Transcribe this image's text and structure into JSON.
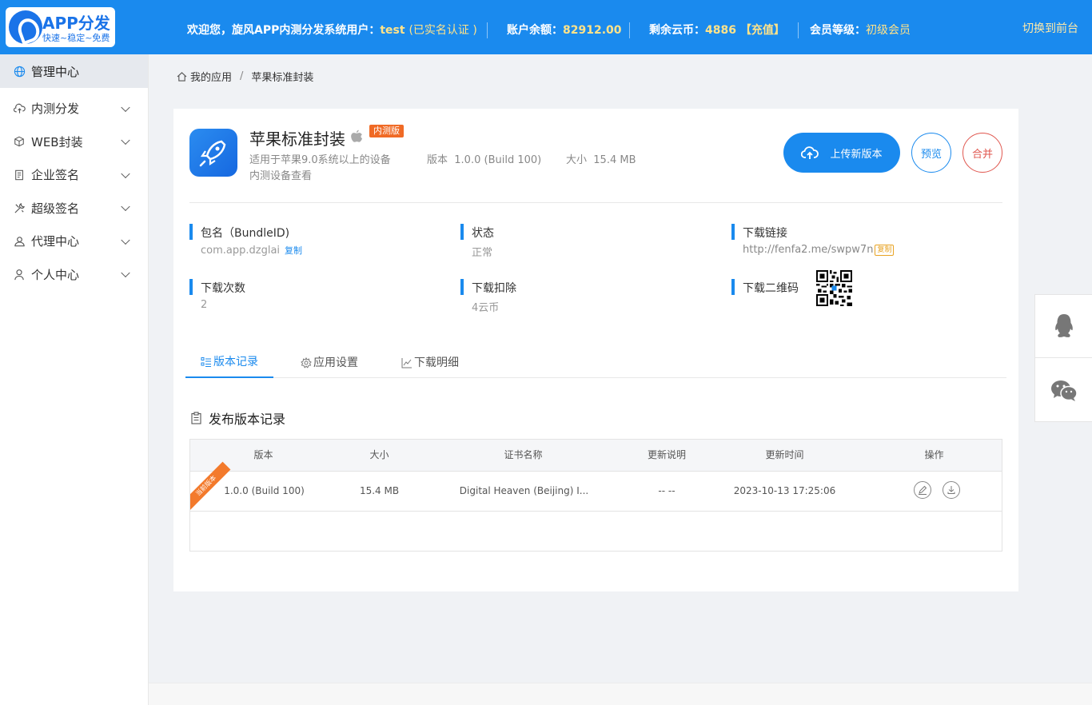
{
  "header": {
    "logo_title": "APP分发",
    "logo_sub": "快速~稳定~免费",
    "welcome_prefix": "欢迎您，旋风APP内测分发系统用户：",
    "username": "test",
    "realname": "(已实名认证 )",
    "balance_label": "账户余额：",
    "balance": "82912.00",
    "coins_label": "剩余云币：",
    "coins": "4886",
    "recharge": "【充值】",
    "level_label": "会员等级：",
    "level": "初级会员",
    "front_link": "切换到前台"
  },
  "sidebar": {
    "items": [
      {
        "label": "管理中心",
        "icon": "globe-icon"
      },
      {
        "label": "内测分发",
        "icon": "cloud-upload-icon"
      },
      {
        "label": "WEB封装",
        "icon": "cube-icon"
      },
      {
        "label": "企业签名",
        "icon": "document-icon"
      },
      {
        "label": "超级签名",
        "icon": "tools-icon"
      },
      {
        "label": "代理中心",
        "icon": "group-icon"
      },
      {
        "label": "个人中心",
        "icon": "user-icon"
      }
    ]
  },
  "breadcrumb": {
    "home": "我的应用",
    "sep": "/",
    "current": "苹果标准封装"
  },
  "app": {
    "name": "苹果标准封装",
    "badge": "内测版",
    "desc": "适用于苹果9.0系统以上的设备",
    "desc2": "内测设备查看",
    "version_label": "版本",
    "version": "1.0.0 (Build 100)",
    "size_label": "大小",
    "size": "15.4 MB"
  },
  "actions": {
    "upload": "上传新版本",
    "preview": "预览",
    "merge": "合并"
  },
  "info": {
    "bundle_label": "包名（BundleID)",
    "bundle_value": "com.app.dzglai",
    "bundle_copy": "复制",
    "status_label": "状态",
    "status_value": "正常",
    "link_label": "下载链接",
    "link_value": "http://fenfa2.me/swpw7n",
    "link_copy": "复制",
    "downloads_label": "下载次数",
    "downloads_value": "2",
    "deduct_label": "下载扣除",
    "deduct_value": "4云币",
    "qr_label": "下载二维码"
  },
  "tabs": [
    "版本记录",
    "应用设置",
    "下载明细"
  ],
  "section_title": "发布版本记录",
  "table": {
    "columns": [
      "版本",
      "大小",
      "证书名称",
      "更新说明",
      "更新时间",
      "操作"
    ],
    "rows": [
      {
        "ribbon": "当前版本",
        "version": "1.0.0 (Build 100)",
        "size": "15.4 MB",
        "cert": "Digital Heaven (Beijing) I...",
        "note": "-- --",
        "time": "2023-10-13 17:25:06"
      }
    ]
  },
  "colors": {
    "primary": "#1a8aee",
    "badge": "#f06a25",
    "danger": "#e0574f",
    "highlight": "#ffe38a"
  }
}
